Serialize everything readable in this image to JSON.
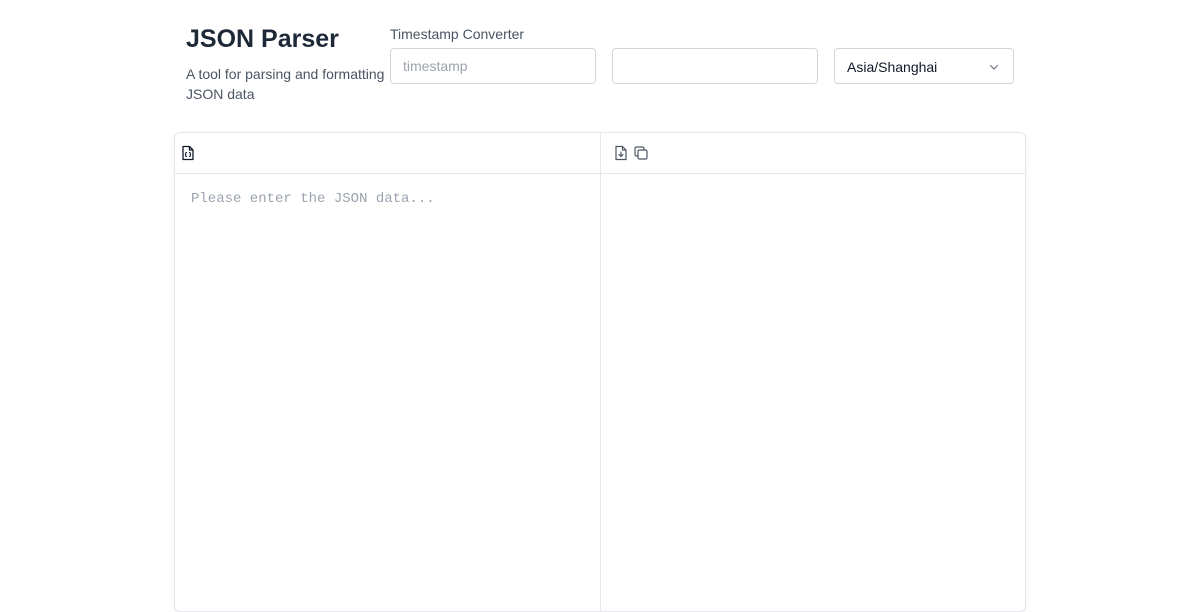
{
  "header": {
    "title": "JSON Parser",
    "subtitle": "A tool for parsing and formatting JSON data"
  },
  "timestamp_converter": {
    "label": "Timestamp Converter",
    "timestamp_placeholder": "timestamp",
    "timestamp_value": "",
    "date_value": "",
    "timezone": "Asia/Shanghai"
  },
  "editor": {
    "input_placeholder": "Please enter the JSON data...",
    "input_value": "",
    "output_value": ""
  },
  "icons": {
    "input_toolbar": [
      "json-file-icon"
    ],
    "output_toolbar": [
      "download-file-icon",
      "copy-icon"
    ]
  }
}
